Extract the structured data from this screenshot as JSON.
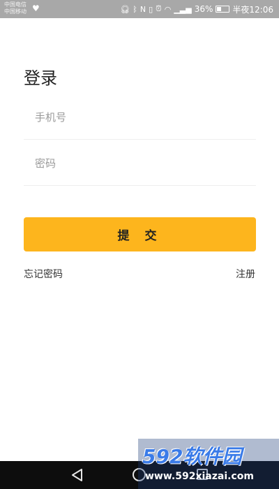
{
  "status_bar": {
    "carrier_1": "中国电信",
    "carrier_2": "中国移动",
    "battery_percent": "36%",
    "time": "半夜12:06",
    "icons": [
      "heart-icon",
      "headphones-icon",
      "bluetooth-icon",
      "nfc-icon",
      "vibrate-icon",
      "alarm-icon",
      "wifi-icon",
      "signal-icon",
      "battery-icon"
    ]
  },
  "login": {
    "title": "登录",
    "phone_placeholder": "手机号",
    "password_placeholder": "密码",
    "submit_label": "提 交",
    "forgot_password_label": "忘记密码",
    "register_label": "注册",
    "accent_color": "#fdb51d"
  },
  "nav_bar": {
    "icons": [
      "back-icon",
      "home-icon",
      "recents-icon"
    ]
  },
  "watermark": {
    "brand": "592软件园",
    "url": "www.592xiazai.com"
  }
}
